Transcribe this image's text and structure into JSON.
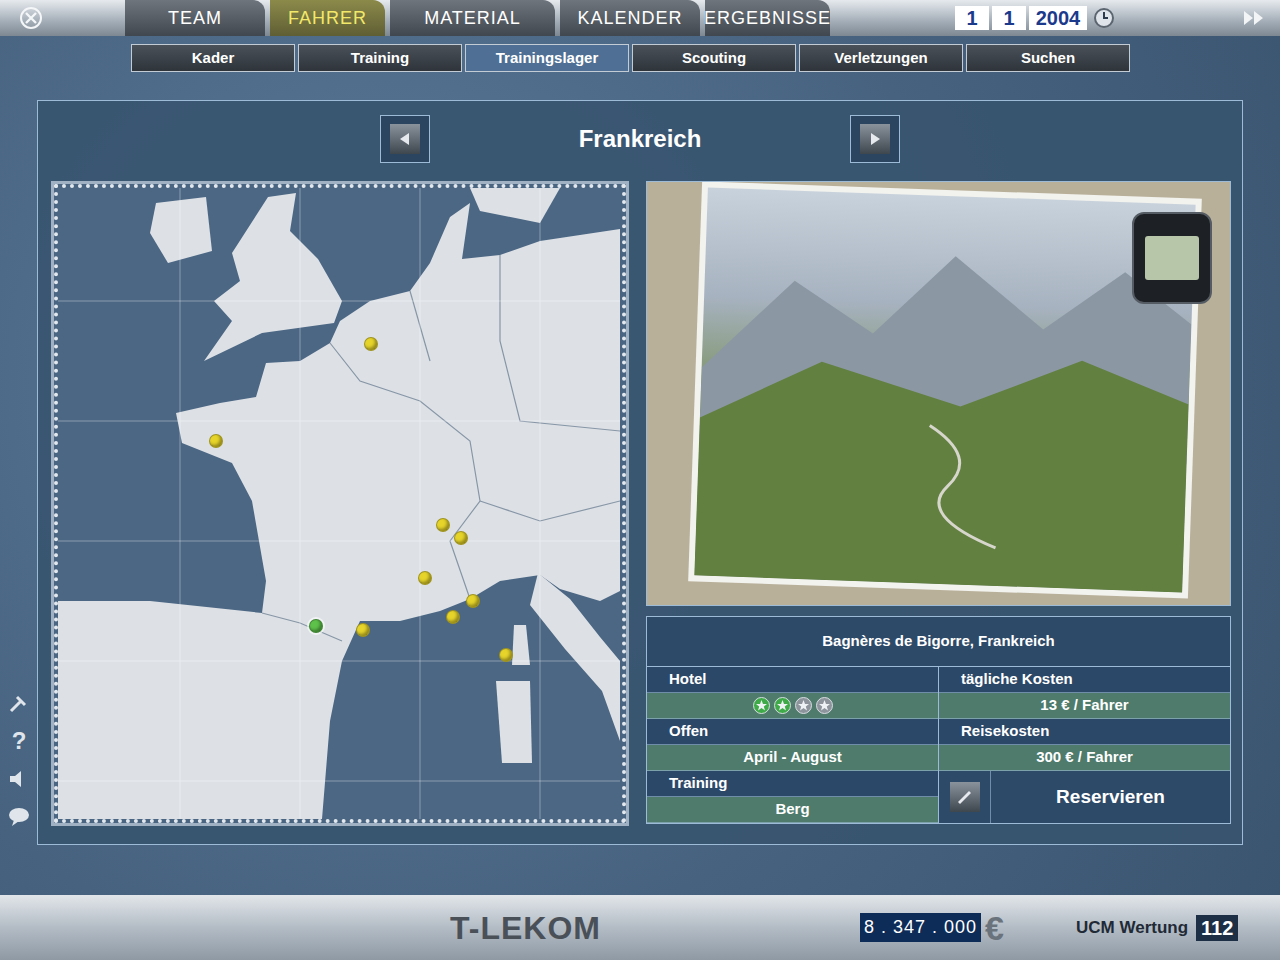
{
  "top_tabs": [
    {
      "label": "TEAM",
      "selected": false
    },
    {
      "label": "FAHRER",
      "selected": true
    },
    {
      "label": "MATERIAL",
      "selected": false
    },
    {
      "label": "KALENDER",
      "selected": false
    },
    {
      "label": "ERGEBNISSE",
      "selected": false
    }
  ],
  "date": [
    "1",
    "1",
    "2004"
  ],
  "sub_tabs": [
    {
      "label": "Kader",
      "selected": false
    },
    {
      "label": "Training",
      "selected": false
    },
    {
      "label": "Trainingslager",
      "selected": true
    },
    {
      "label": "Scouting",
      "selected": false
    },
    {
      "label": "Verletzungen",
      "selected": false
    },
    {
      "label": "Suchen",
      "selected": false
    }
  ],
  "panel": {
    "title": "Frankreich"
  },
  "map": {
    "pins": [
      {
        "selected": false,
        "color": "#e6d42a"
      },
      {
        "selected": false,
        "color": "#e6d42a"
      },
      {
        "selected": false,
        "color": "#e6d42a"
      },
      {
        "selected": false,
        "color": "#e6d42a"
      },
      {
        "selected": false,
        "color": "#e6d42a"
      },
      {
        "selected": false,
        "color": "#e6d42a"
      },
      {
        "selected": false,
        "color": "#e6d42a"
      },
      {
        "selected": false,
        "color": "#e6d42a"
      },
      {
        "selected": true,
        "color": "#5ec24a"
      },
      {
        "selected": false,
        "color": "#e6d42a"
      }
    ]
  },
  "camp": {
    "title": "Bagnères de Bigorre, Frankreich",
    "left": [
      {
        "label": "Hotel",
        "kind": "stars",
        "stars": 2,
        "stars_max": 4
      },
      {
        "label": "Offen",
        "kind": "text",
        "value": "April - August"
      },
      {
        "label": "Training",
        "kind": "text",
        "value": "Berg"
      }
    ],
    "right": [
      {
        "label": "tägliche Kosten",
        "value": "13 € / Fahrer"
      },
      {
        "label": "Reisekosten",
        "value": "300 € / Fahrer"
      }
    ],
    "reserve_button": "Reservieren"
  },
  "sidebar": {
    "help": "?"
  },
  "footer": {
    "team": "T-LEKOM",
    "budget": "8 . 347 . 000",
    "currency": "€",
    "ranking_label": "UCM Wertung",
    "ranking": "112"
  }
}
